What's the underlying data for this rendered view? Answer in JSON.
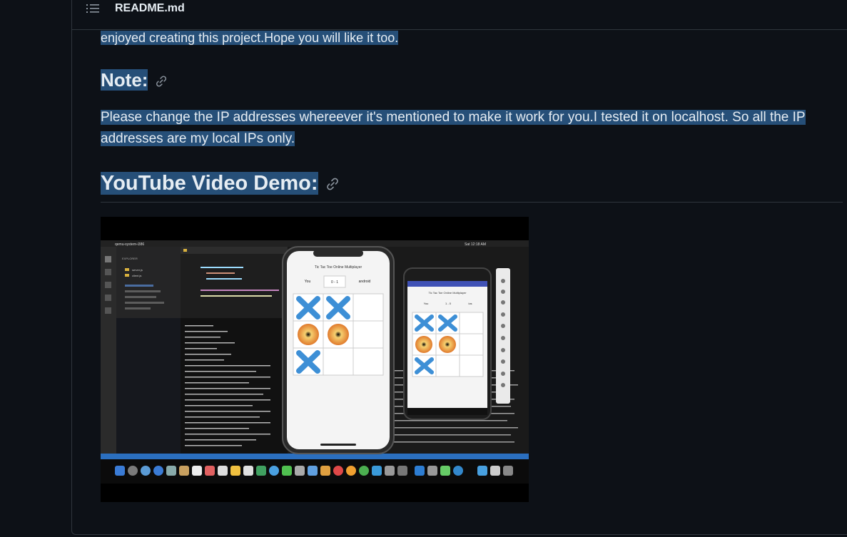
{
  "header": {
    "title": "README.md",
    "icon": "list-icon"
  },
  "readme": {
    "intro_tail": "enjoyed creating this project.Hope you will like it too.",
    "note_heading": "Note:",
    "note_text": "Please change the IP addresses whereever it's mentioned to make it work for you.I tested it on localhost. So all the IP addresses are my local IPs only.",
    "video_heading": "YouTube Video Demo:"
  },
  "video": {
    "window_title": "qemu-system-i386",
    "clock": "Sat 12:18 AM",
    "game_title_large": "Tic Tac Toe Online Multiplayer",
    "game_title_small": "Tic Tac Toe Online Multiplayer",
    "player_you": "You",
    "score_large": "0 - 1",
    "opponent_large": "android",
    "score_small": "1 - 0",
    "opponent_small": "ios",
    "file_server": "server.js",
    "file_client": "client.js"
  },
  "colors": {
    "selection": "#264f78",
    "background": "#0d1117",
    "border": "#30363d",
    "x_mark": "#3d8fd6",
    "o_mark": "#e8873a"
  }
}
